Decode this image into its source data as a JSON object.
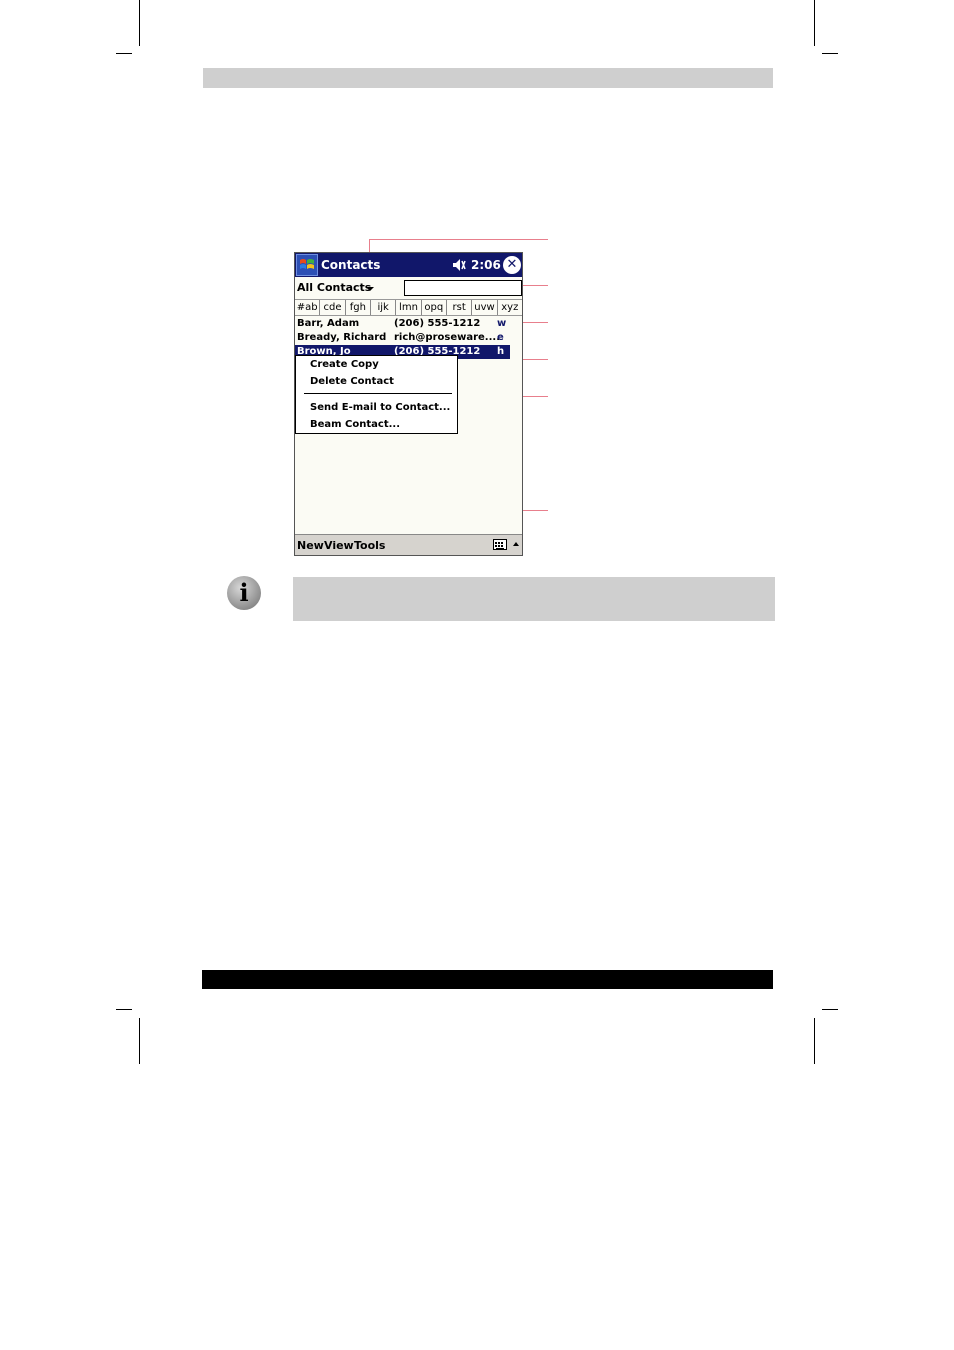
{
  "device": {
    "title": "Contacts",
    "clock": "2:06",
    "close_glyph": "✕",
    "icons": {
      "start": "windows-flag-icon",
      "volume": "speaker-icon",
      "close": "close-icon"
    },
    "filter_label": "All Contacts",
    "letter_tabs": [
      "#ab",
      "cde",
      "fgh",
      "ijk",
      "lmn",
      "opq",
      "rst",
      "uvw",
      "xyz"
    ],
    "contacts": [
      {
        "name": "Barr, Adam",
        "info": "(206) 555-1212",
        "type": "w",
        "selected": false
      },
      {
        "name": "Bready, Richard",
        "info": "rich@proseware....",
        "type": "e",
        "selected": false
      },
      {
        "name": "Brown, Jo",
        "info": "(206) 555-1212",
        "type": "h",
        "selected": true
      }
    ],
    "context_menu": [
      "Create Copy",
      "Delete Contact",
      "Send E-mail to Contact...",
      "Beam Contact..."
    ],
    "menubar": [
      "New",
      "View",
      "Tools"
    ]
  },
  "note": {
    "icon": "info-icon",
    "icon_glyph": "i"
  },
  "colors": {
    "titlebar": "#11176a",
    "callout": "#e87f8c",
    "selection": "#11176a"
  }
}
